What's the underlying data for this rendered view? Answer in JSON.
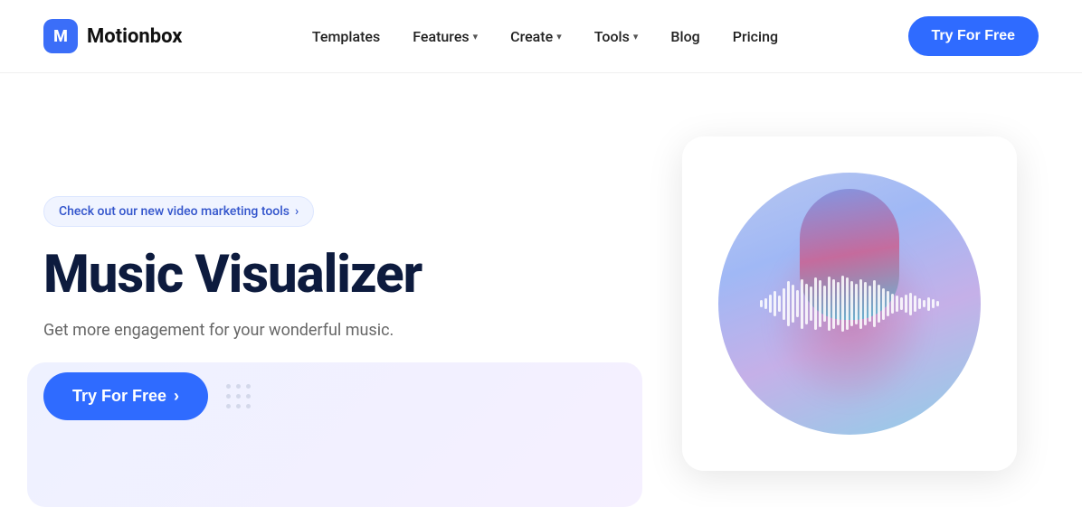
{
  "logo": {
    "icon_text": "M",
    "name": "Motionbox"
  },
  "nav": {
    "links": [
      {
        "label": "Templates",
        "has_dropdown": false
      },
      {
        "label": "Features",
        "has_dropdown": true
      },
      {
        "label": "Create",
        "has_dropdown": true
      },
      {
        "label": "Tools",
        "has_dropdown": true
      },
      {
        "label": "Blog",
        "has_dropdown": false
      },
      {
        "label": "Pricing",
        "has_dropdown": false
      }
    ],
    "cta_label": "Try For Free"
  },
  "hero": {
    "badge_text": "Check out our new video marketing tools",
    "badge_chevron": "›",
    "title": "Music Visualizer",
    "subtitle": "Get more engagement for your wonderful music.",
    "cta_label": "Try For Free",
    "cta_arrow": "›"
  },
  "colors": {
    "primary": "#2f6bff",
    "text_dark": "#0d1b3e",
    "text_muted": "#666666"
  }
}
